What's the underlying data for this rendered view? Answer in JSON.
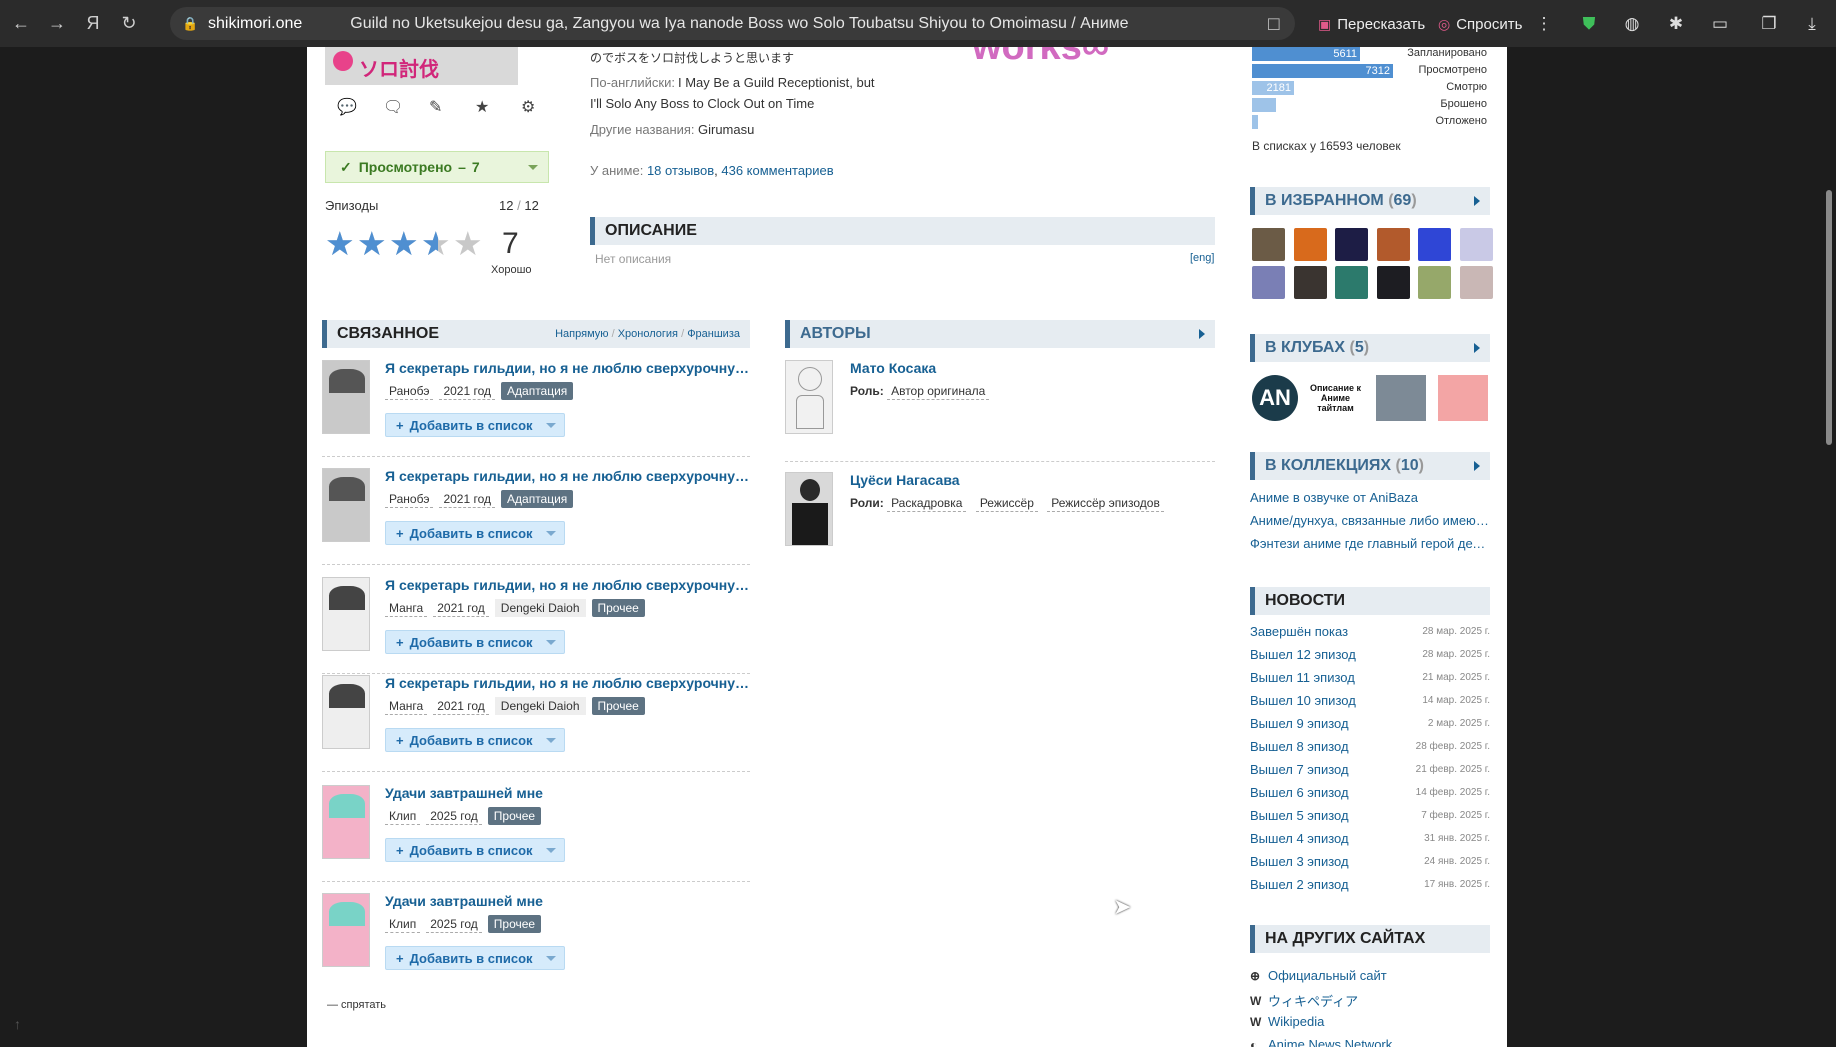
{
  "browser": {
    "domain": "shikimori.one",
    "page_title": "Guild no Uketsukejou desu ga, Zangyou wa Iya nanode Boss wo Solo Toubatsu Shiyou to Omoimasu / Аниме",
    "retell_label": "Пересказать",
    "ask_label": "Спросить"
  },
  "anime": {
    "cover_text": "ソロ討伐",
    "jp_title_tail": "のでボスをソロ討伐しようと思います",
    "english_label": "По-английски:",
    "english_title_line1": "I May Be a Guild Receptionist, but",
    "english_title_line2": "I'll Solo Any Boss to Clock Out on Time",
    "other_names_label": "Другие названия:",
    "other_names": "Girumasu",
    "studio_logo_text": "works∞",
    "anime_label": "У аниме:",
    "reviews_link": "18 отзывов",
    "comments_link": "436 комментариев",
    "status_label": "Просмотрено",
    "status_sep": "–",
    "status_score": "7",
    "episodes_label": "Эпизоды",
    "episodes_watched": "12",
    "episodes_sep": "/",
    "episodes_total": "12",
    "rating_value": "7",
    "rating_text": "Хорошо",
    "rating_fraction": 0.7
  },
  "description": {
    "header": "ОПИСАНИЕ",
    "text": "Нет описания",
    "lang_link": "[eng]"
  },
  "related": {
    "header": "СВЯЗАННОЕ",
    "filters": [
      "Напрямую",
      "Хронология",
      "Франшиза"
    ],
    "filter_sep": "/",
    "add_label": "Добавить в список",
    "items": [
      {
        "title": "Я секретарь гильдии, но я не люблю сверхурочную работу",
        "kind": "Ранобэ",
        "year": "2021 год",
        "tag": "Адаптация",
        "extra": ""
      },
      {
        "title": "Я секретарь гильдии, но я не люблю сверхурочную работу",
        "kind": "Ранобэ",
        "year": "2021 год",
        "tag": "Адаптация",
        "extra": ""
      },
      {
        "title": "Я секретарь гильдии, но я не люблю сверхурочную работу",
        "kind": "Манга",
        "year": "2021 год",
        "tag": "Прочее",
        "extra": "Dengeki Daioh"
      },
      {
        "title": "Я секретарь гильдии, но я не люблю сверхурочную работу",
        "kind": "Манга",
        "year": "2021 год",
        "tag": "Прочее",
        "extra": "Dengeki Daioh"
      },
      {
        "title": "Удачи завтрашней мне",
        "kind": "Клип",
        "year": "2025 год",
        "tag": "Прочее",
        "extra": ""
      },
      {
        "title": "Удачи завтрашней мне",
        "kind": "Клип",
        "year": "2025 год",
        "tag": "Прочее",
        "extra": ""
      }
    ],
    "hide_label": "— спрятать"
  },
  "authors": {
    "header": "АВТОРЫ",
    "people": [
      {
        "name": "Мато Косака",
        "roles_label": "Роль:",
        "roles": [
          "Автор оригинала"
        ]
      },
      {
        "name": "Цуёси Нагасава",
        "roles_label": "Роли:",
        "roles": [
          "Раскадровка",
          "Режиссёр",
          "Режиссёр эпизодов"
        ]
      }
    ]
  },
  "stats": {
    "rows": [
      {
        "value": "5611",
        "label": "Запланировано",
        "fraction": 0.72
      },
      {
        "value": "7312",
        "label": "Просмотрено",
        "fraction": 0.94
      },
      {
        "value": "2181",
        "label": "Смотрю",
        "fraction": 0.28
      },
      {
        "value": "",
        "label": "Брошено",
        "fraction": 0.16
      },
      {
        "value": "",
        "label": "Отложено",
        "fraction": 0.04
      }
    ],
    "in_lists": "В списках у 16593 человек"
  },
  "favourites": {
    "header": "В ИЗБРАННОМ",
    "count": "69",
    "colors": [
      "#6b5b46",
      "#d86a1c",
      "#1d1d45",
      "#b25a2c",
      "#2f46d6",
      "#c9c9e6",
      "#7a7fb5",
      "#3a3430",
      "#2c7a6c",
      "#1d1d22",
      "#96a86a",
      "#c9b7b5"
    ]
  },
  "clubs": {
    "header": "В КЛУБАХ",
    "count": "5",
    "anime_club_text": "Описание к Аниме тайтлам"
  },
  "collections": {
    "header": "В КОЛЛЕКЦИЯХ",
    "count": "10",
    "items": [
      "Аниме в озвучке от AniBaza",
      "Аниме/дунхуа, связанные либо имеющие",
      "Фэнтези аниме где главный герой делает"
    ]
  },
  "news": {
    "header": "НОВОСТИ",
    "items": [
      {
        "title": "Завершён показ",
        "date": "28 мар. 2025 г."
      },
      {
        "title": "Вышел 12 эпизод",
        "date": "28 мар. 2025 г."
      },
      {
        "title": "Вышел 11 эпизод",
        "date": "21 мар. 2025 г."
      },
      {
        "title": "Вышел 10 эпизод",
        "date": "14 мар. 2025 г."
      },
      {
        "title": "Вышел 9 эпизод",
        "date": "2 мар. 2025 г."
      },
      {
        "title": "Вышел 8 эпизод",
        "date": "28 февр. 2025 г."
      },
      {
        "title": "Вышел 7 эпизод",
        "date": "21 февр. 2025 г."
      },
      {
        "title": "Вышел 6 эпизод",
        "date": "14 февр. 2025 г."
      },
      {
        "title": "Вышел 5 эпизод",
        "date": "7 февр. 2025 г."
      },
      {
        "title": "Вышел 4 эпизод",
        "date": "31 янв. 2025 г."
      },
      {
        "title": "Вышел 3 эпизод",
        "date": "24 янв. 2025 г."
      },
      {
        "title": "Вышел 2 эпизод",
        "date": "17 янв. 2025 г."
      }
    ]
  },
  "other_sites": {
    "header": "НА ДРУГИХ САЙТАХ",
    "items": [
      "Официальный сайт",
      "ウィキペディア",
      "Wikipedia",
      "Anime News Network"
    ]
  }
}
